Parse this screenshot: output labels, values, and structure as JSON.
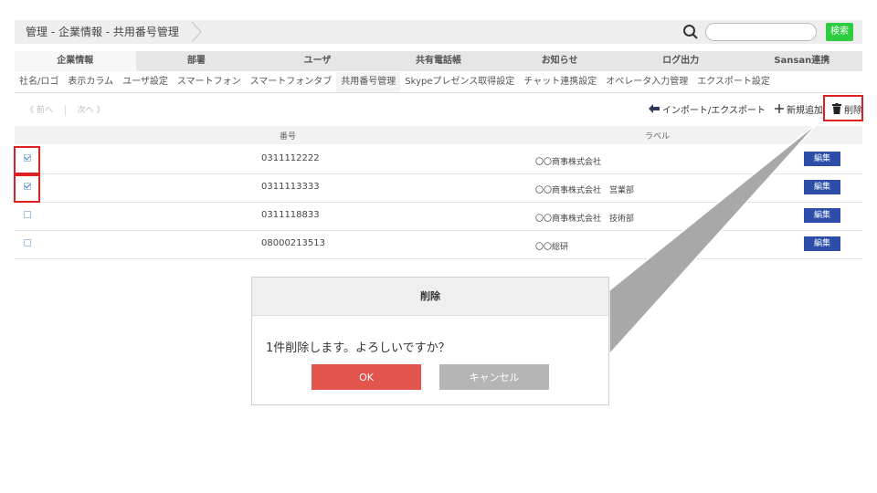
{
  "header": {
    "breadcrumb": "管理 - 企業情報 - 共用番号管理",
    "search_button": "検索",
    "search_placeholder": ""
  },
  "tabs": [
    {
      "label": "企業情報",
      "active": true
    },
    {
      "label": "部署",
      "active": false
    },
    {
      "label": "ユーザ",
      "active": false
    },
    {
      "label": "共有電話帳",
      "active": false
    },
    {
      "label": "お知らせ",
      "active": false
    },
    {
      "label": "ログ出力",
      "active": false
    },
    {
      "label": "Sansan連携",
      "active": false
    }
  ],
  "subtabs": [
    {
      "label": "社名/ロゴ"
    },
    {
      "label": "表示カラム"
    },
    {
      "label": "ユーザ設定"
    },
    {
      "label": "スマートフォン"
    },
    {
      "label": "スマートフォンタブ"
    },
    {
      "label": "共用番号管理",
      "active": true
    },
    {
      "label": "Skypeプレゼンス取得設定"
    },
    {
      "label": "チャット連携設定"
    },
    {
      "label": "オペレータ入力管理"
    },
    {
      "label": "エクスポート設定"
    }
  ],
  "pager": {
    "prev": "《 前へ",
    "next": "次へ 》"
  },
  "toolbar": {
    "import_export": "インポート/エクスポート",
    "add_new": "新規追加",
    "delete": "削除"
  },
  "table": {
    "columns": {
      "number": "番号",
      "label": "ラベル"
    },
    "rows": [
      {
        "checked": true,
        "number": "0311112222",
        "label": "〇〇商事株式会社",
        "edit": "編集"
      },
      {
        "checked": true,
        "number": "0311113333",
        "label": "〇〇商事株式会社　営業部",
        "edit": "編集"
      },
      {
        "checked": false,
        "number": "0311118833",
        "label": "〇〇商事株式会社　技術部",
        "edit": "編集"
      },
      {
        "checked": false,
        "number": "08000213513",
        "label": "〇〇総研",
        "edit": "編集"
      }
    ]
  },
  "dialog": {
    "title": "削除",
    "message": "1件削除します。よろしいですか？",
    "ok": "OK",
    "cancel": "キャンセル"
  },
  "colors": {
    "accent_green": "#2ecc40",
    "edit_blue": "#2d4ea8",
    "ok_red": "#e2554c",
    "highlight_red": "#e02020"
  }
}
